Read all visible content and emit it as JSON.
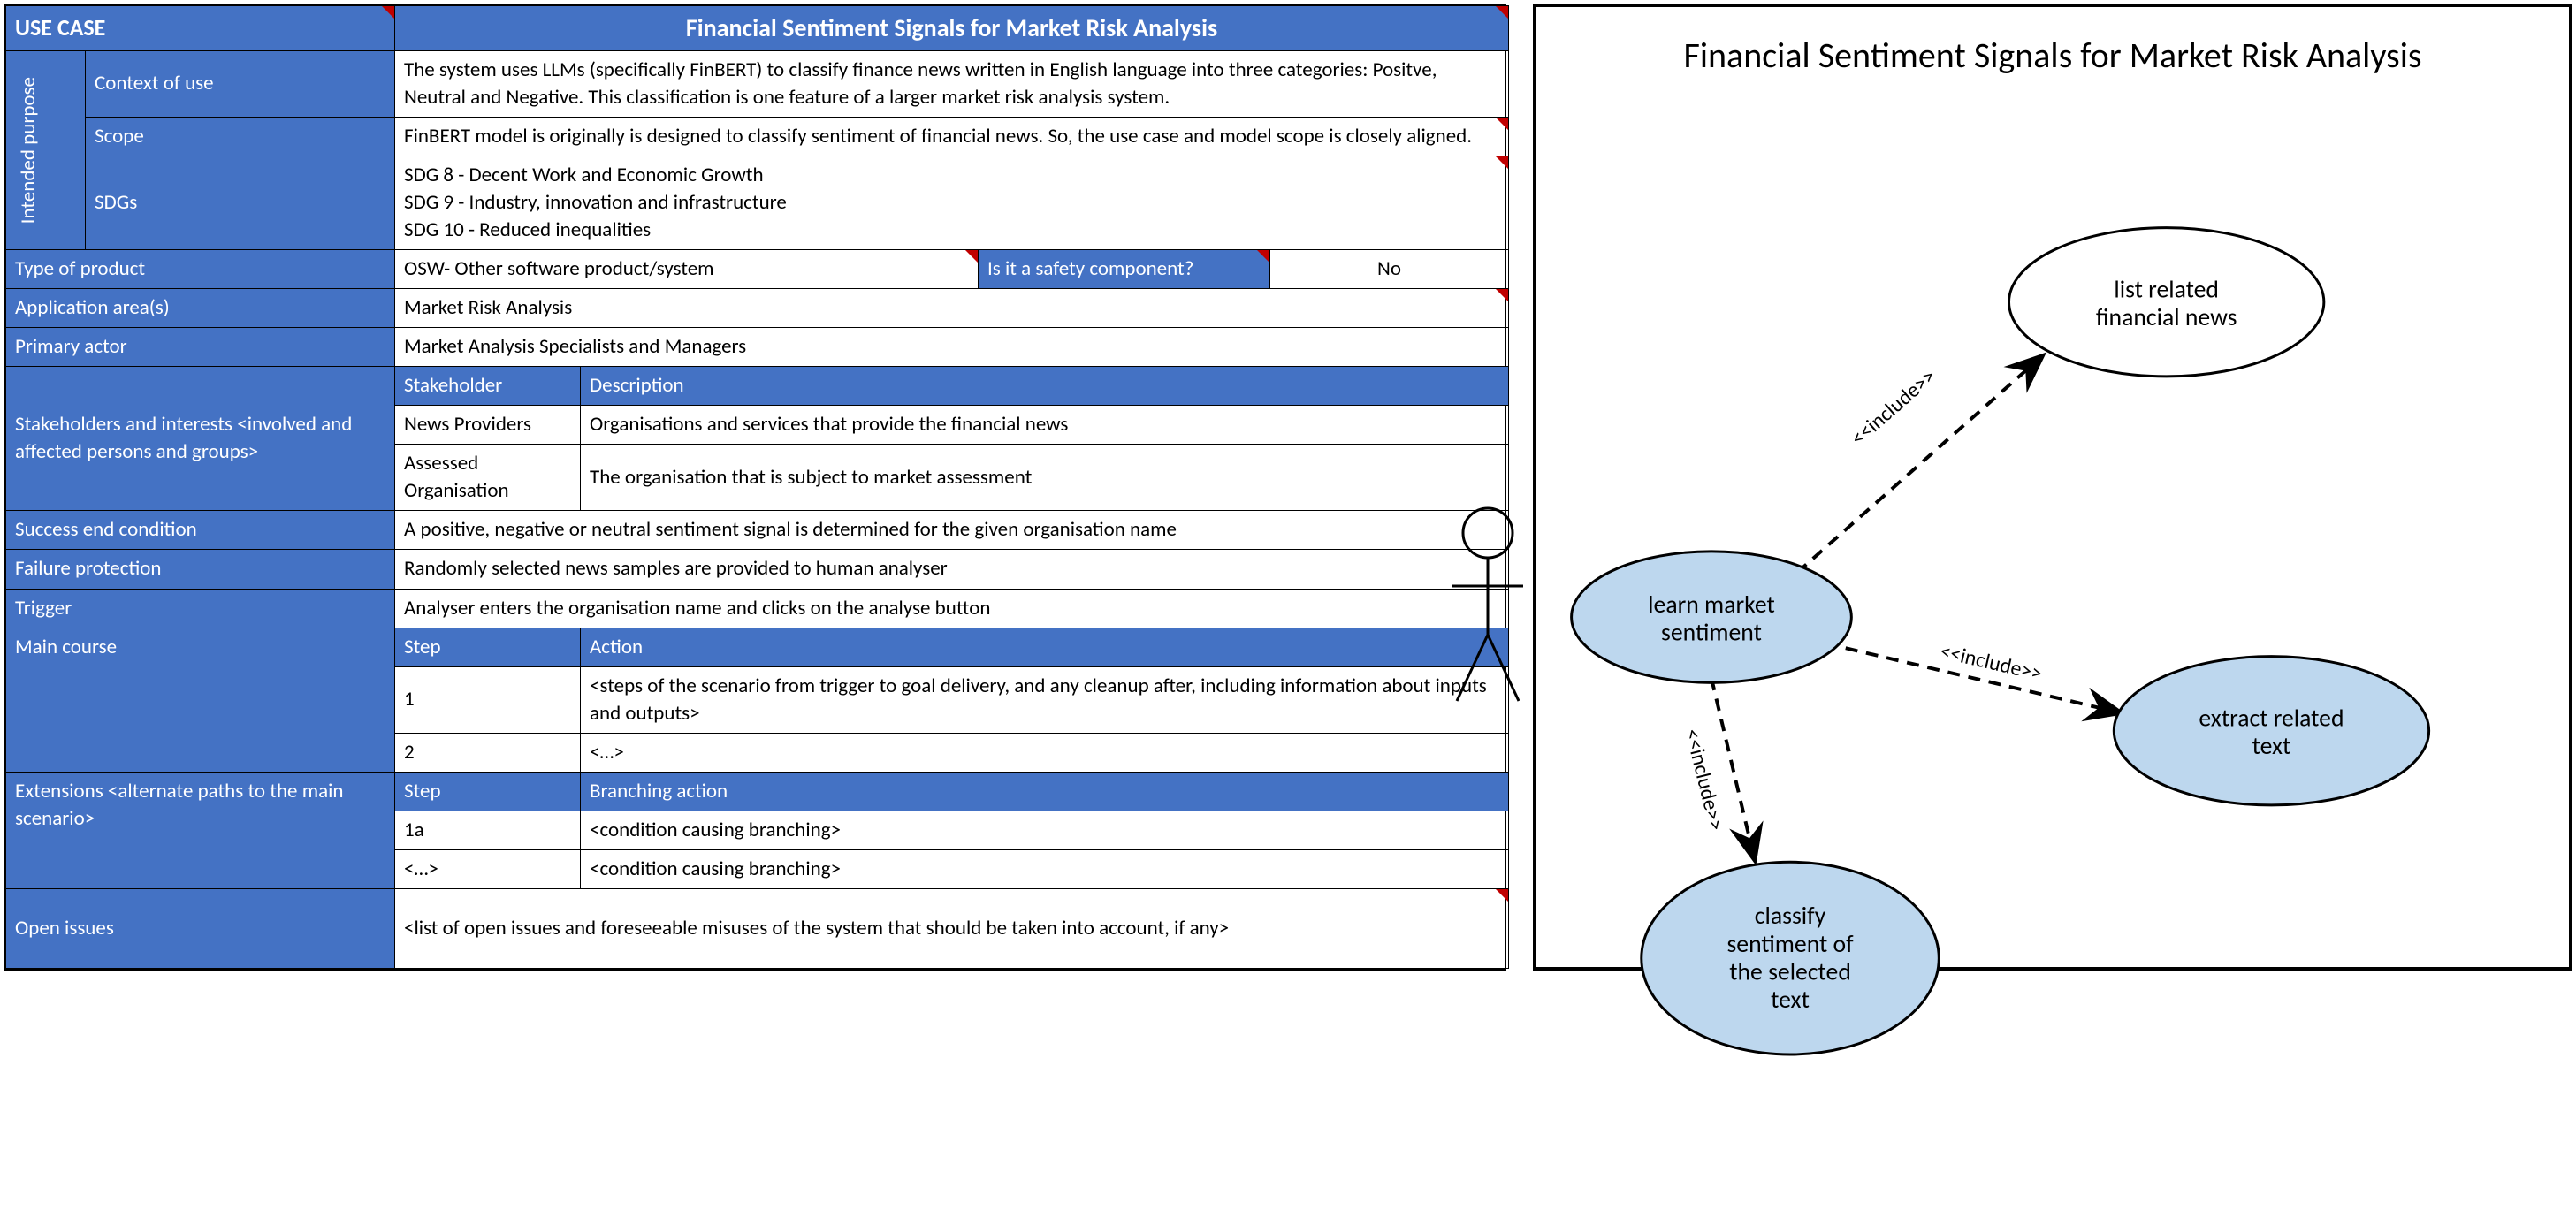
{
  "header": {
    "usecase_label": "USE CASE",
    "title": "Financial Sentiment Signals for Market Risk Analysis"
  },
  "intended_purpose": {
    "group_label": "Intended purpose",
    "context_label": "Context of use",
    "context_value": "The system uses LLMs (specifically FinBERT) to classify finance news written in English language into three categories: Positve, Neutral and Negative. This classification is one feature of a larger market risk analysis system.",
    "scope_label": "Scope",
    "scope_value": "FinBERT model is originally is designed to classify sentiment of financial news. So, the use case and model scope is closely aligned.",
    "sdgs_label": "SDGs",
    "sdgs_line1": "SDG 8 - Decent Work and Economic Growth",
    "sdgs_line2": "SDG 9 - Industry, innovation and infrastructure",
    "sdgs_line3": "SDG 10 - Reduced inequalities"
  },
  "product": {
    "type_label": "Type of product",
    "type_value": "OSW- Other software product/system",
    "safety_label": "Is it a safety component?",
    "safety_value": "No"
  },
  "rows": {
    "app_area_label": "Application area(s)",
    "app_area_value": "Market Risk Analysis",
    "primary_actor_label": "Primary actor",
    "primary_actor_value": "Market Analysis Specialists and Managers",
    "stakeholders_label": "Stakeholders and interests <involved and affected persons and groups>",
    "stakeholder_col": "Stakeholder",
    "description_col": "Description",
    "stakeholder1_name": "News Providers",
    "stakeholder1_desc": "Organisations and services that provide the financial news",
    "stakeholder2_name": "Assessed Organisation",
    "stakeholder2_desc": "The organisation that is subject to market assessment",
    "success_label": "Success end condition",
    "success_value": "A positive, negative or neutral sentiment signal is determined for the given organisation name",
    "failure_label": "Failure protection",
    "failure_value": "Randomly selected news samples are provided to human analyser",
    "trigger_label": "Trigger",
    "trigger_value": "Analyser enters the organisation name and clicks on the analyse button",
    "main_course_label": "Main course",
    "step_col": "Step",
    "action_col": "Action",
    "step1_no": "1",
    "step1_action": "<steps of the scenario from trigger to goal delivery, and any cleanup after, including information about inputs and outputs>",
    "step2_no": "2",
    "step2_action": "<…>",
    "extensions_label": "Extensions <alternate paths to the main scenario>",
    "branching_col": "Branching action",
    "ext_step_col": "Step",
    "ext1_no": "1a",
    "ext1_action": "<condition causing branching>",
    "ext2_no": "<…>",
    "ext2_action": "<condition causing branching>",
    "open_issues_label": "Open issues",
    "open_issues_value": "<list of open issues and foreseeable misuses of the system that should be taken into account, if any>"
  },
  "diagram": {
    "title": "Financial Sentiment Signals for Market Risk Analysis",
    "include_label": "<<include>>",
    "node_main_l1": "learn market",
    "node_main_l2": "sentiment",
    "node_news_l1": "list related",
    "node_news_l2": "financial news",
    "node_extract_l1": "extract related",
    "node_extract_l2": "text",
    "node_classify_l1": "classify",
    "node_classify_l2": "sentiment of",
    "node_classify_l3": "the selected",
    "node_classify_l4": "text"
  }
}
